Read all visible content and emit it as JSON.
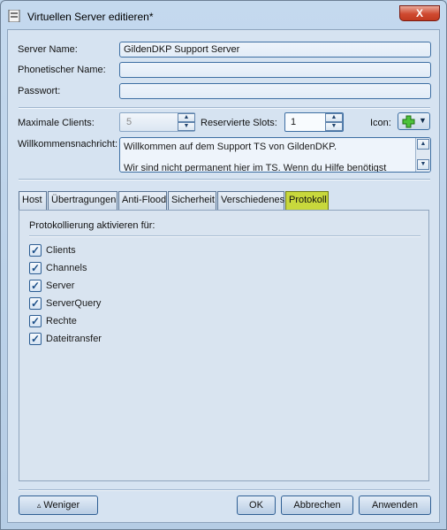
{
  "window": {
    "title": "Virtuellen Server editieren*",
    "close_glyph": "X"
  },
  "form": {
    "server_name_label": "Server Name:",
    "server_name_value": "GildenDKP Support Server",
    "phonetic_label": "Phonetischer Name:",
    "phonetic_value": "",
    "password_label": "Passwort:",
    "password_value": "",
    "max_clients_label": "Maximale Clients:",
    "max_clients_value": "5",
    "reserved_slots_label": "Reservierte Slots:",
    "reserved_slots_value": "1",
    "icon_label": "Icon:",
    "welcome_label": "Willkommensnachricht:",
    "welcome_line1": "Willkommen auf dem Support TS von GildenDKP.",
    "welcome_line2": "Wir sind nicht permanent hier im TS. Wenn du Hilfe benötigst"
  },
  "tabs": [
    {
      "label": "Host"
    },
    {
      "label": "Übertragungen"
    },
    {
      "label": "Anti-Flood"
    },
    {
      "label": "Sicherheit"
    },
    {
      "label": "Verschiedenes"
    },
    {
      "label": "Protokoll",
      "active": true
    }
  ],
  "protokoll": {
    "heading": "Protokollierung aktivieren für:",
    "options": [
      {
        "label": "Clients",
        "checked": true
      },
      {
        "label": "Channels",
        "checked": true
      },
      {
        "label": "Server",
        "checked": true
      },
      {
        "label": "ServerQuery",
        "checked": true
      },
      {
        "label": "Rechte",
        "checked": true
      },
      {
        "label": "Dateitransfer",
        "checked": true
      }
    ]
  },
  "buttons": {
    "less_glyph": "▵",
    "less": "Weniger",
    "ok": "OK",
    "cancel": "Abbrechen",
    "apply": "Anwenden"
  },
  "colors": {
    "active_tab": "#c8d83c",
    "accent_border": "#3e6fa3"
  }
}
